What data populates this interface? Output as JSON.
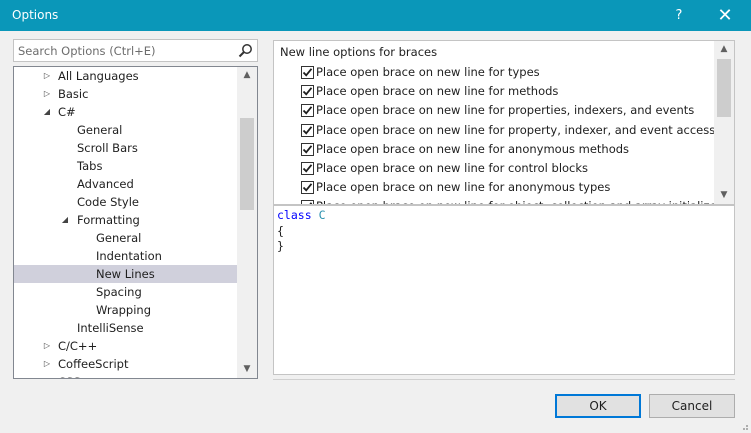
{
  "window": {
    "title": "Options",
    "help_label": "?",
    "close_label": "✕"
  },
  "search": {
    "placeholder": "Search Options (Ctrl+E)"
  },
  "tree": {
    "items": [
      {
        "label": "All Languages",
        "arrow": "▷",
        "depth": 1
      },
      {
        "label": "Basic",
        "arrow": "▷",
        "depth": 1
      },
      {
        "label": "C#",
        "arrow": "◢",
        "depth": 1
      },
      {
        "label": "General",
        "arrow": "",
        "depth": 2
      },
      {
        "label": "Scroll Bars",
        "arrow": "",
        "depth": 2
      },
      {
        "label": "Tabs",
        "arrow": "",
        "depth": 2
      },
      {
        "label": "Advanced",
        "arrow": "",
        "depth": 2
      },
      {
        "label": "Code Style",
        "arrow": "",
        "depth": 2
      },
      {
        "label": "Formatting",
        "arrow": "◢",
        "depth": 2
      },
      {
        "label": "General",
        "arrow": "",
        "depth": 3
      },
      {
        "label": "Indentation",
        "arrow": "",
        "depth": 3
      },
      {
        "label": "New Lines",
        "arrow": "",
        "depth": 3,
        "selected": true
      },
      {
        "label": "Spacing",
        "arrow": "",
        "depth": 3
      },
      {
        "label": "Wrapping",
        "arrow": "",
        "depth": 3
      },
      {
        "label": "IntelliSense",
        "arrow": "",
        "depth": 2
      },
      {
        "label": "C/C++",
        "arrow": "▷",
        "depth": 1
      },
      {
        "label": "CoffeeScript",
        "arrow": "▷",
        "depth": 1
      },
      {
        "label": "CSS",
        "arrow": "▷",
        "depth": 1
      }
    ]
  },
  "options": {
    "section_title": "New line options for braces",
    "items": [
      {
        "label": "Place open brace on new line for types",
        "checked": true
      },
      {
        "label": "Place open brace on new line for methods",
        "checked": true
      },
      {
        "label": "Place open brace on new line for properties, indexers, and events",
        "checked": true
      },
      {
        "label": "Place open brace on new line for property, indexer, and event accessors",
        "checked": true
      },
      {
        "label": "Place open brace on new line for anonymous methods",
        "checked": true
      },
      {
        "label": "Place open brace on new line for control blocks",
        "checked": true
      },
      {
        "label": "Place open brace on new line for anonymous types",
        "checked": true
      },
      {
        "label": "Place open brace on new line for object, collection and array initializers",
        "checked": true
      }
    ]
  },
  "preview": {
    "keyword": "class",
    "class_name": "C",
    "open_brace": "{",
    "close_brace": "}"
  },
  "buttons": {
    "ok": "OK",
    "cancel": "Cancel"
  },
  "colors": {
    "titlebar": "#0a97b9",
    "selection": "#d0d0dc",
    "keyword": "#0000ff",
    "type_name": "#2b91af",
    "default_button_border": "#0078d7"
  }
}
